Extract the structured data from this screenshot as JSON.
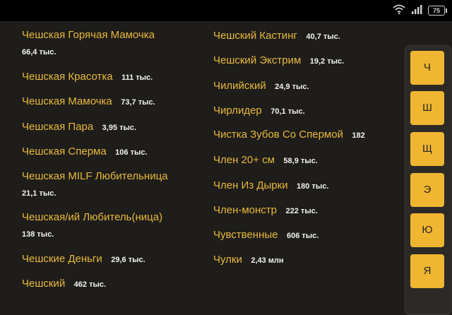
{
  "status_bar": {
    "battery_level": "75",
    "icons": [
      "wifi-icon",
      "signal-icon",
      "battery-icon"
    ]
  },
  "left_column": [
    {
      "name": "Чешская Горячая Мамочка",
      "count": "66,4 тыс."
    },
    {
      "name": "Чешская Красотка",
      "count": "111 тыс."
    },
    {
      "name": "Чешская Мамочка",
      "count": "73,7 тыс."
    },
    {
      "name": "Чешская Пара",
      "count": "3,95 тыс."
    },
    {
      "name": "Чешская Сперма",
      "count": "106 тыс."
    },
    {
      "name": "Чешская MILF Любительница",
      "count": "21,1 тыс."
    },
    {
      "name": "Чешская/ий Любитель(ница)",
      "count": "138 тыс."
    },
    {
      "name": "Чешские Деньги",
      "count": "29,6 тыс."
    },
    {
      "name": "Чешский",
      "count": "462 тыс."
    }
  ],
  "right_column": [
    {
      "name": "Чешский Кастинг",
      "count": "40,7 тыс."
    },
    {
      "name": "Чешский Экстрим",
      "count": "19,2 тыс."
    },
    {
      "name": "Чилийский",
      "count": "24,9 тыс."
    },
    {
      "name": "Чирлидер",
      "count": "70,1 тыс."
    },
    {
      "name": "Чистка Зубов Со Спермой",
      "count": "182"
    },
    {
      "name": "Член 20+ см",
      "count": "58,9 тыс."
    },
    {
      "name": "Член Из Дырки",
      "count": "180 тыс."
    },
    {
      "name": "Член-монстр",
      "count": "222 тыс."
    },
    {
      "name": "Чувственные",
      "count": "606 тыс."
    },
    {
      "name": "Чулки",
      "count": "2,43 млн"
    }
  ],
  "alphabet_index": [
    "Ч",
    "Ш",
    "Щ",
    "Э",
    "Ю",
    "Я"
  ],
  "colors": {
    "background": "#1f1d1a",
    "accent": "#f0b631",
    "item_name": "#e8b93d",
    "count_text": "#f2f2f2"
  }
}
